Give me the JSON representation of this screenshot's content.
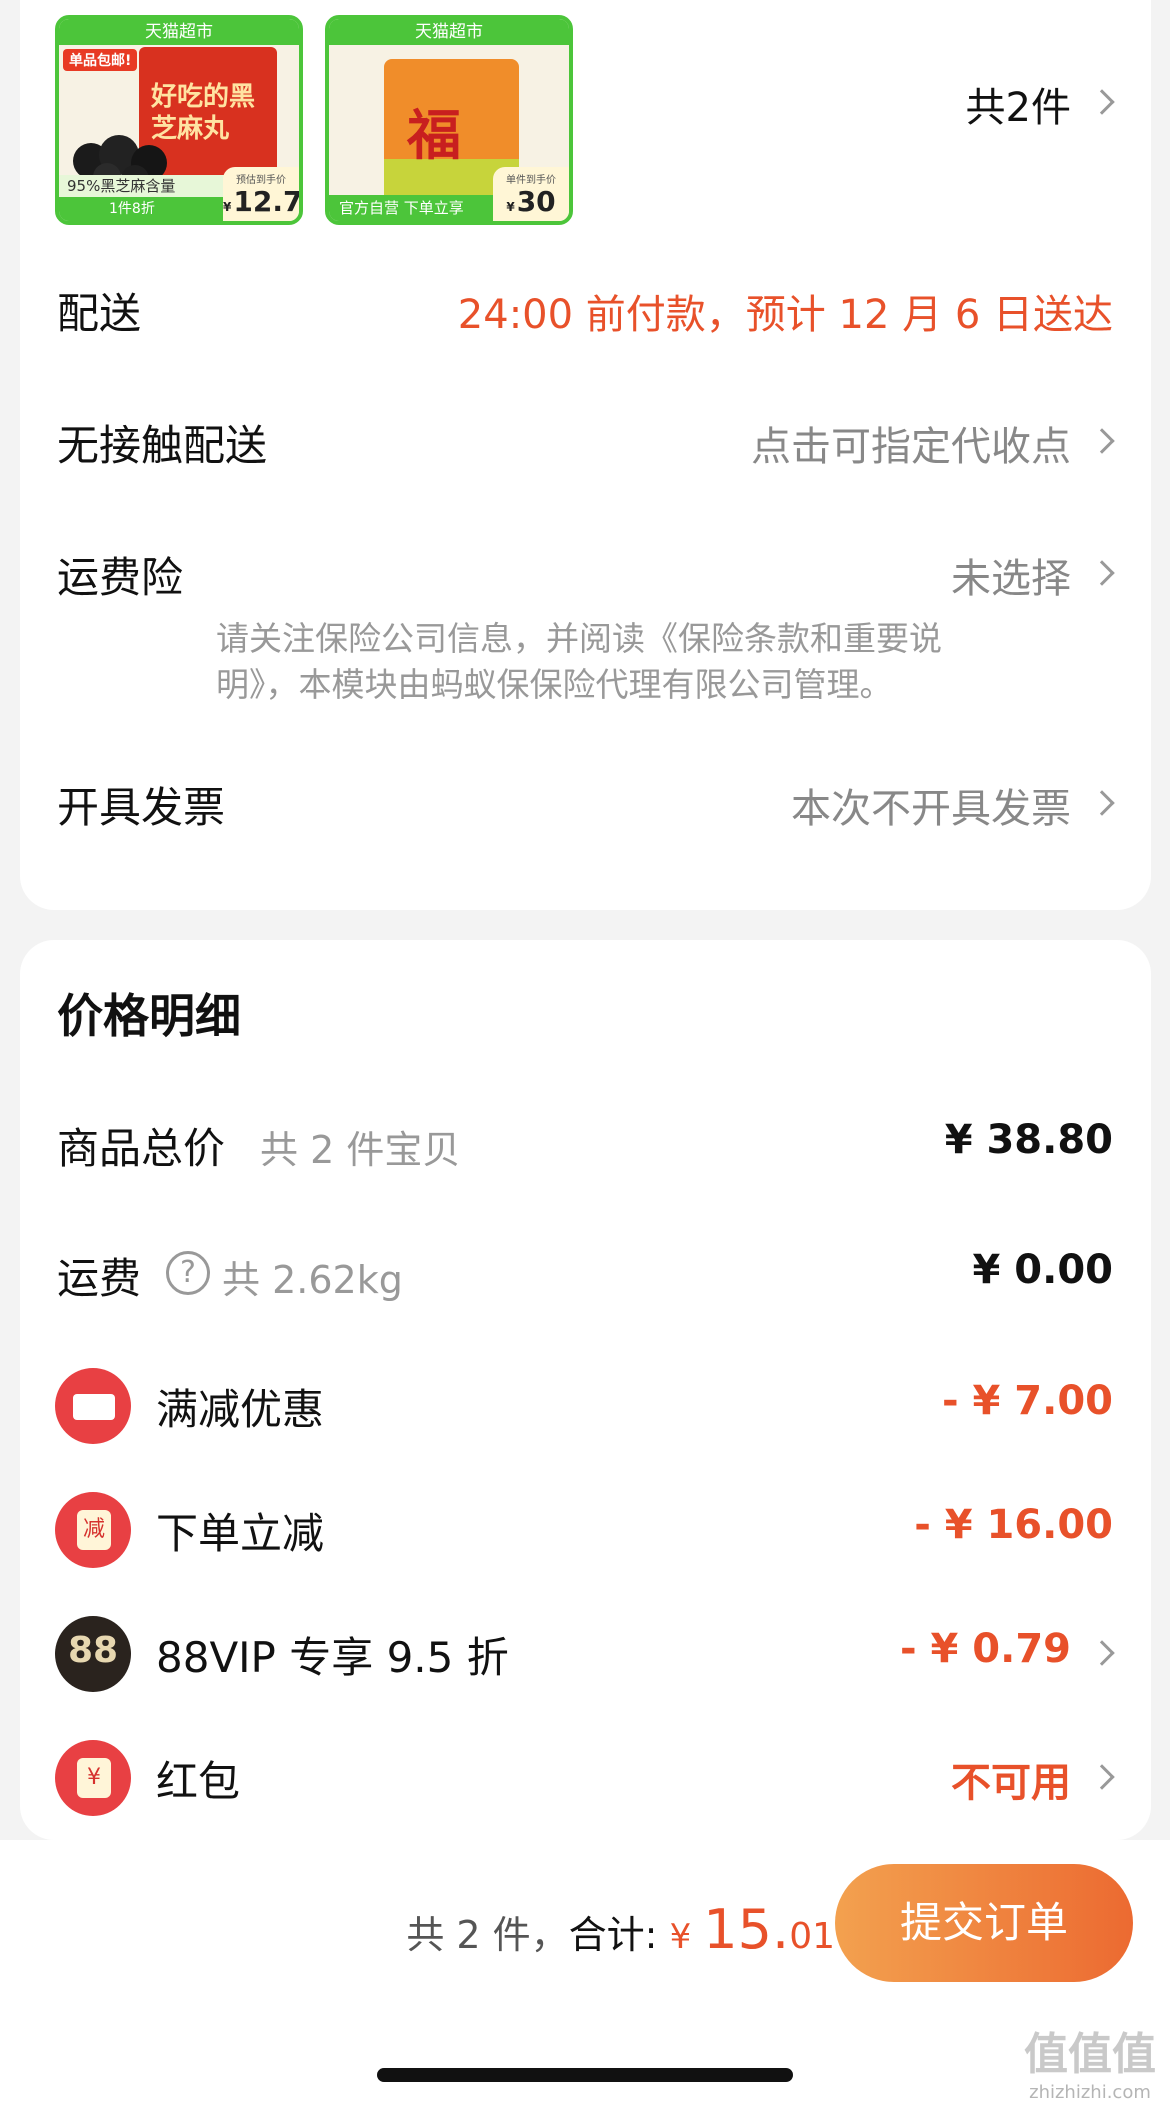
{
  "products": {
    "items": [
      {
        "ribbon": "天猫超市",
        "tag": "单品包邮!",
        "pack_text": "好吃的黑芝麻丸",
        "bottom_line1": "95%黑芝麻含量",
        "bottom_line2": "1件8折",
        "price_label": "预估到手价",
        "price_currency": "¥",
        "price_value": "12.7"
      },
      {
        "ribbon": "天猫超市",
        "pack_text": "福",
        "bottom_line1": "官方自营  下单立享",
        "price_label": "单件到手价",
        "price_currency": "¥",
        "price_value": "30"
      }
    ],
    "count_label": "共2件"
  },
  "delivery": {
    "label": "配送",
    "value": "24:00 前付款，预计 12 月 6 日送达"
  },
  "contactless": {
    "label": "无接触配送",
    "value": "点击可指定代收点"
  },
  "shipping_insurance": {
    "label": "运费险",
    "value": "未选择",
    "note_line1": "请关注保险公司信息，并阅读《保险条款和重要说",
    "note_line2": "明》，本模块由蚂蚁保保险代理有限公司管理。"
  },
  "invoice": {
    "label": "开具发票",
    "value": "本次不开具发票"
  },
  "price_detail": {
    "title": "价格明细",
    "goods_total": {
      "label": "商品总价",
      "sub": "共 2 件宝贝",
      "value": "¥ 38.80"
    },
    "shipping": {
      "label": "运费",
      "sub": "共 2.62kg",
      "value": "¥ 0.00"
    },
    "full_reduction": {
      "label": "满减优惠",
      "value": "- ¥ 7.00"
    },
    "order_discount": {
      "label": "下单立减",
      "badge": "减",
      "value": "- ¥ 16.00"
    },
    "vip": {
      "label": "88VIP 专享 9.5 折",
      "badge": "88",
      "value": "- ¥ 0.79"
    },
    "red_packet": {
      "label": "红包",
      "badge": "¥",
      "value": "不可用"
    }
  },
  "footer": {
    "count": "共 2 件，",
    "total_label": "合计:",
    "currency": "¥",
    "total_int": "15.",
    "total_dec": "01",
    "submit_label": "提交订单",
    "watermark": "值值值",
    "watermark_url": "zhizhizhi.com"
  },
  "colors": {
    "accent": "#e8512a",
    "submit_gradient_start": "#f3a14f",
    "submit_gradient_end": "#ec6a31",
    "tmall_green": "#4cc53a"
  }
}
